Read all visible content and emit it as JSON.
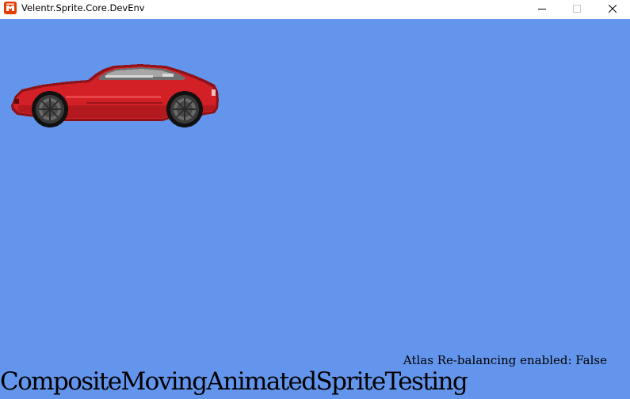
{
  "window": {
    "title": "Velentr.Sprite.Core.DevEnv",
    "app_icon": "monogame-logo-icon",
    "controls": {
      "minimize_icon": "minimize-icon",
      "maximize_icon": "maximize-icon",
      "close_icon": "close-icon"
    }
  },
  "viewport": {
    "background_color": "#6495ed",
    "sprite": "red-sports-car-sprite",
    "status_text": "Atlas Re-balancing enabled: False",
    "scene_name": "CompositeMovingAnimatedSpriteTesting"
  }
}
